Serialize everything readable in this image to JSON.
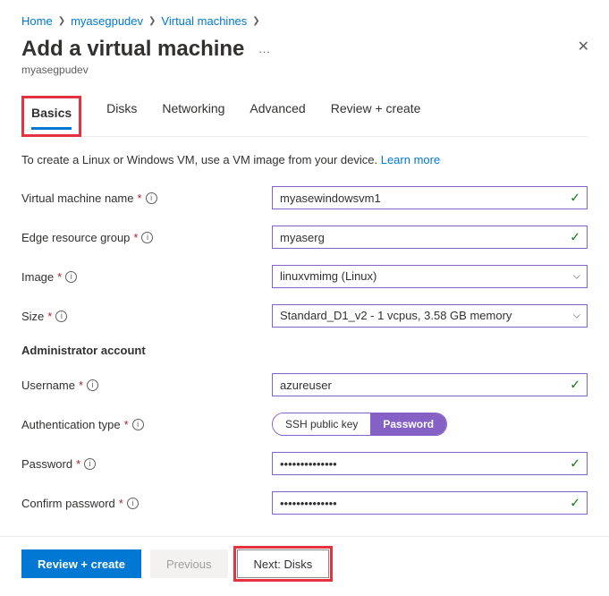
{
  "breadcrumb": {
    "items": [
      "Home",
      "myasegpudev",
      "Virtual machines"
    ]
  },
  "header": {
    "title": "Add a virtual machine",
    "subtitle": "myasegpudev"
  },
  "tabs": {
    "items": [
      "Basics",
      "Disks",
      "Networking",
      "Advanced",
      "Review + create"
    ],
    "active": "Basics"
  },
  "description": {
    "text": "To create a Linux or Windows VM, use a VM image from your device. ",
    "link": "Learn more"
  },
  "form": {
    "vm_name": {
      "label": "Virtual machine name",
      "value": "myasewindowsvm1"
    },
    "resource_group": {
      "label": "Edge resource group",
      "value": "myaserg"
    },
    "image": {
      "label": "Image",
      "value": "linuxvmimg (Linux)"
    },
    "size": {
      "label": "Size",
      "value": "Standard_D1_v2 - 1 vcpus, 3.58 GB memory"
    },
    "admin_section": "Administrator account",
    "username": {
      "label": "Username",
      "value": "azureuser"
    },
    "auth_type": {
      "label": "Authentication type",
      "options": [
        "SSH public key",
        "Password"
      ],
      "selected": "Password"
    },
    "password": {
      "label": "Password",
      "value": "••••••••••••••"
    },
    "confirm_password": {
      "label": "Confirm password",
      "value": "••••••••••••••"
    }
  },
  "footer": {
    "review": "Review + create",
    "previous": "Previous",
    "next": "Next: Disks"
  }
}
